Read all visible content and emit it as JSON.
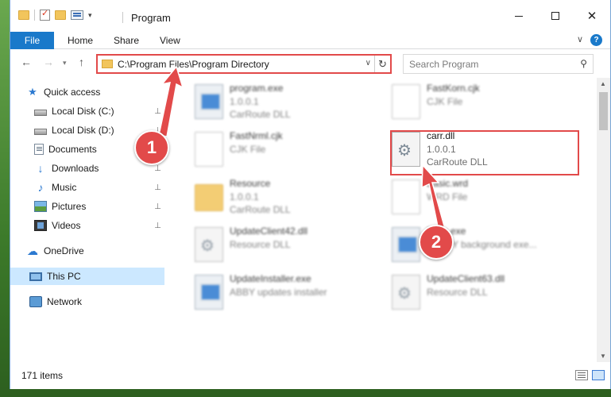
{
  "window": {
    "title": "Program",
    "buttons": {
      "minimize": "minimize",
      "maximize": "maximize",
      "close": "✕"
    }
  },
  "ribbon": {
    "tabs": [
      "File",
      "Home",
      "Share",
      "View"
    ],
    "help": "?"
  },
  "nav": {
    "back": "←",
    "forward": "→",
    "recent_dropdown": "▾",
    "up": "↑",
    "address": "C:\\Program Files\\Program Directory",
    "address_dropdown": "∨",
    "refresh": "↻",
    "search_placeholder": "Search Program",
    "search_icon": "⚲"
  },
  "sidebar": {
    "items": [
      {
        "label": "Quick access",
        "icon": "star-icon",
        "pinned": false
      },
      {
        "label": "Local Disk (C:)",
        "icon": "disk-icon",
        "pinned": true
      },
      {
        "label": "Local Disk (D:)",
        "icon": "disk-icon",
        "pinned": true
      },
      {
        "label": "Documents",
        "icon": "documents-icon",
        "pinned": true
      },
      {
        "label": "Downloads",
        "icon": "downloads-icon",
        "pinned": true
      },
      {
        "label": "Music",
        "icon": "music-icon",
        "pinned": true
      },
      {
        "label": "Pictures",
        "icon": "pictures-icon",
        "pinned": true
      },
      {
        "label": "Videos",
        "icon": "videos-icon",
        "pinned": true
      },
      {
        "label": "OneDrive",
        "icon": "onedrive-icon",
        "pinned": false
      },
      {
        "label": "This PC",
        "icon": "this-pc-icon",
        "pinned": false,
        "selected": true
      },
      {
        "label": "Network",
        "icon": "network-icon",
        "pinned": false
      }
    ],
    "pin_glyph": "📌"
  },
  "files": [
    {
      "name": "program.exe",
      "line2": "1.0.0.1",
      "line3": "CarRoute DLL",
      "icon": "exe-icon"
    },
    {
      "name": "FastKorn.cjk",
      "line2": "CJK File",
      "line3": "",
      "icon": "document-icon"
    },
    {
      "name": "FastNrml.cjk",
      "line2": "CJK File",
      "line3": "",
      "icon": "document-icon"
    },
    {
      "name": "carr.dll",
      "line2": "1.0.0.1",
      "line3": "CarRoute DLL",
      "icon": "dll-gear-icon",
      "highlighted": true
    },
    {
      "name": "Resource",
      "line2": "1.0.0.1",
      "line3": "CarRoute DLL",
      "icon": "folder-icon"
    },
    {
      "name": "Basic.wrd",
      "line2": "WRD File",
      "line3": "",
      "icon": "document-icon"
    },
    {
      "name": "UpdateClient42.dll",
      "line2": "Resource DLL",
      "line3": "",
      "icon": "dll-gear-icon"
    },
    {
      "name": "Exec.exe",
      "line2": "ABBYY background exe...",
      "line3": "",
      "icon": "exe-icon"
    },
    {
      "name": "UpdateInstaller.exe",
      "line2": "ABBY updates installer",
      "line3": "",
      "icon": "exe-icon"
    },
    {
      "name": "UpdateClient63.dll",
      "line2": "Resource DLL",
      "line3": "",
      "icon": "dll-gear-icon"
    }
  ],
  "status": {
    "item_count": "171 items"
  },
  "callouts": {
    "step1": "1",
    "step2": "2"
  },
  "colors": {
    "accent": "#1979ca",
    "callout": "#e24a4a",
    "selected": "#cce8ff"
  }
}
